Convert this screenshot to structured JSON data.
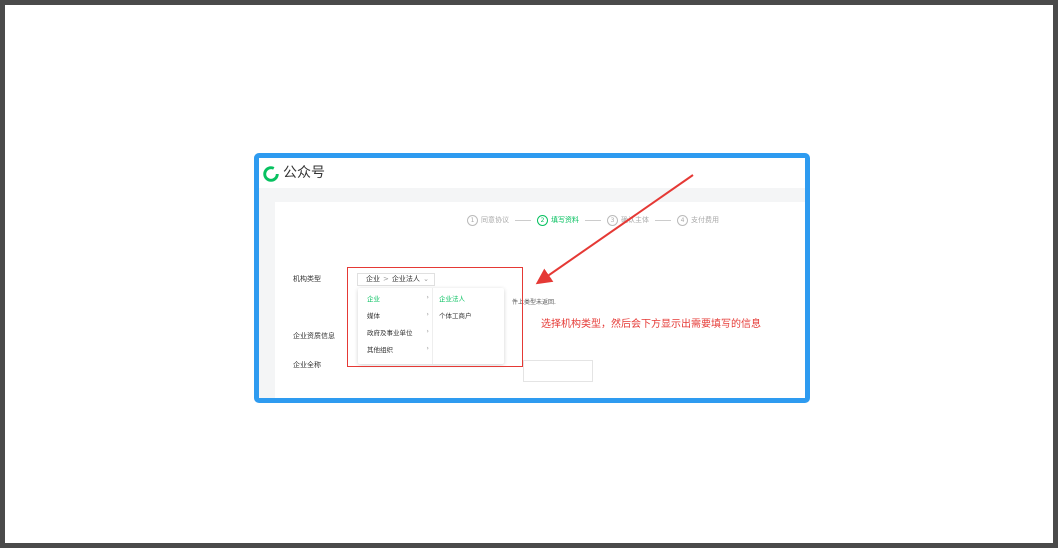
{
  "app": {
    "title": "公众号"
  },
  "steps": [
    {
      "num": "1",
      "label": "同意协议",
      "active": false
    },
    {
      "num": "2",
      "label": "填写资料",
      "active": true
    },
    {
      "num": "3",
      "label": "确认主体",
      "active": false
    },
    {
      "num": "4",
      "label": "支付费用",
      "active": false
    }
  ],
  "form": {
    "org_type_label": "机构类型",
    "select": {
      "level1": "企业",
      "separator": ">",
      "level2": "企业法人"
    },
    "hint_text": "件上类型未返回.",
    "qualification_label": "企业资质信息",
    "full_name_label": "企业全称"
  },
  "menu": {
    "level1": [
      {
        "label": "企业",
        "active": true
      },
      {
        "label": "媒体",
        "active": false
      },
      {
        "label": "政府及事业单位",
        "active": false
      },
      {
        "label": "其他组织",
        "active": false
      }
    ],
    "level2": [
      {
        "label": "企业法人",
        "active": true
      },
      {
        "label": "个体工商户",
        "active": false
      }
    ]
  },
  "annotation": {
    "text": "选择机构类型，然后会下方显示出需要填写的信息",
    "color": "#e53935"
  },
  "colors": {
    "accent": "#07c160",
    "frame_border": "#2e9bf0",
    "outer_border": "#4a4a4a"
  }
}
